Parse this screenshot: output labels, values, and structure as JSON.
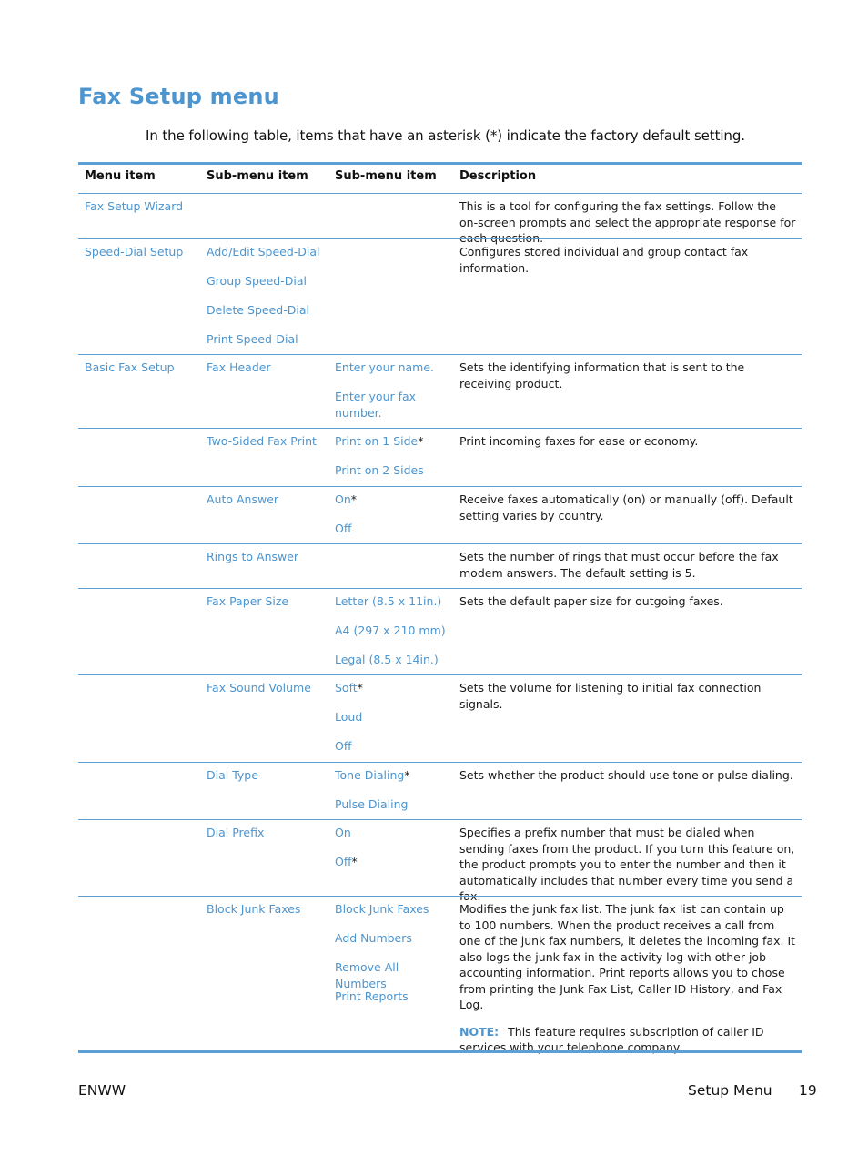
{
  "title": "Fax Setup menu",
  "intro": "In the following table, items that have an asterisk (*) indicate the factory default setting.",
  "table": {
    "headers": [
      "Menu item",
      "Sub-menu item",
      "Sub-menu item",
      "Description"
    ],
    "rows": [
      {
        "menu": "Fax Setup Wizard",
        "sub1": [],
        "sub2": [],
        "description": "This is a tool for configuring the fax settings. Follow the on-screen prompts and select the appropriate response for each question."
      },
      {
        "menu": "Speed-Dial Setup",
        "sub1": [
          "Add/Edit Speed-Dial",
          "Group Speed-Dial",
          "Delete Speed-Dial",
          "Print Speed-Dial"
        ],
        "sub2": [],
        "description": "Configures stored individual and group contact fax information."
      },
      {
        "menu": "Basic Fax Setup",
        "sub1": [
          "Fax Header"
        ],
        "sub2": [
          "Enter your name.",
          "Enter your fax number."
        ],
        "description": "Sets the identifying information that is sent to the receiving product."
      },
      {
        "menu": "",
        "sub1": [
          "Two-Sided Fax Print"
        ],
        "sub2": [
          "Print on 1 Side",
          "Print on 2 Sides"
        ],
        "sub2_default": [
          true,
          false
        ],
        "description": "Print incoming faxes for ease or economy."
      },
      {
        "menu": "",
        "sub1": [
          "Auto Answer"
        ],
        "sub2": [
          "On",
          "Off"
        ],
        "sub2_default": [
          true,
          false
        ],
        "description": "Receive faxes automatically (on) or manually (off). Default setting varies by country."
      },
      {
        "menu": "",
        "sub1": [
          "Rings to Answer"
        ],
        "sub2": [],
        "description": "Sets the number of rings that must occur before the fax modem answers. The default setting is 5."
      },
      {
        "menu": "",
        "sub1": [
          "Fax Paper Size"
        ],
        "sub2": [
          "Letter (8.5 x 11in.)",
          "A4 (297 x 210 mm)",
          "Legal (8.5 x 14in.)"
        ],
        "description": "Sets the default paper size for outgoing faxes."
      },
      {
        "menu": "",
        "sub1": [
          "Fax Sound Volume"
        ],
        "sub2": [
          "Soft",
          "Loud",
          "Off"
        ],
        "sub2_default": [
          true,
          false,
          false
        ],
        "description": "Sets the volume for listening to initial fax connection signals."
      },
      {
        "menu": "",
        "sub1": [
          "Dial Type"
        ],
        "sub2": [
          "Tone Dialing",
          "Pulse Dialing"
        ],
        "sub2_default": [
          true,
          false
        ],
        "description": "Sets whether the product should use tone or pulse dialing."
      },
      {
        "menu": "",
        "sub1": [
          "Dial Prefix"
        ],
        "sub2": [
          "On",
          "Off"
        ],
        "sub2_default": [
          false,
          true
        ],
        "description": "Specifies a prefix number that must be dialed when sending faxes from the product. If you turn this feature on, the product prompts you to enter the number and then it automatically includes that number every time you send a fax."
      },
      {
        "menu": "",
        "sub1": [
          "Block Junk Faxes"
        ],
        "sub2": [
          "Block Junk Faxes",
          "Add Numbers",
          "Remove All Numbers",
          "Print Reports"
        ],
        "description": "Modifies the junk fax list. The junk fax list can contain up to 100 numbers. When the product receives a call from one of the junk fax numbers, it deletes the incoming fax. It also logs the junk fax in the activity log with other job-accounting information. Print reports allows you to chose from printing the Junk Fax List, Caller ID History, and Fax Log.",
        "note_label": "NOTE:",
        "note": "This feature requires subscription of caller ID services with your telephone company."
      }
    ]
  },
  "default_marker": "*",
  "footer": {
    "left": "ENWW",
    "section": "Setup Menu",
    "page": "19"
  }
}
